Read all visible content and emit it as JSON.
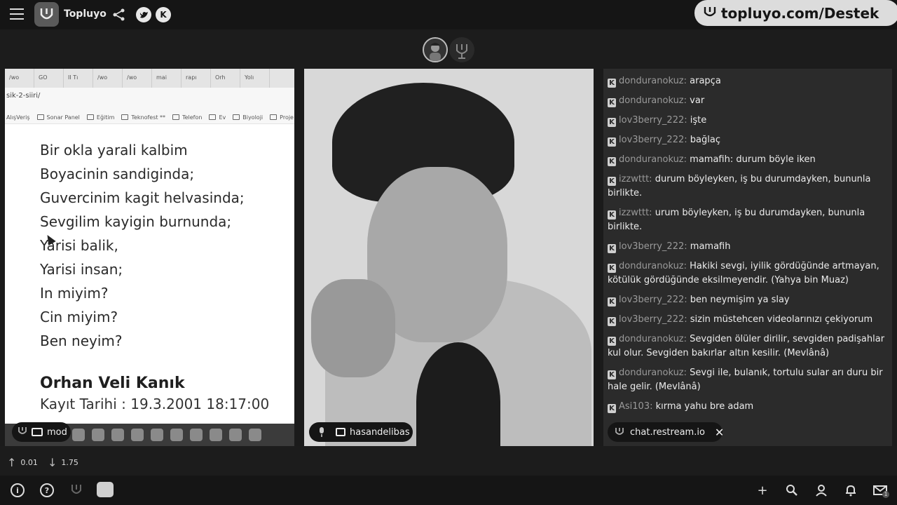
{
  "app": {
    "title": "Topluyo",
    "support_label": "topluyo.com/Destek"
  },
  "browser": {
    "tabs": [
      "/wo",
      "GO",
      "II Tı",
      "/wo",
      "/wo",
      "mai",
      "rapı",
      "Orh",
      "Yolı"
    ],
    "url": "sik-2-siiri/",
    "bookmarks": [
      "AlışVeriş",
      "Sonar Panel",
      "Eğitim",
      "Teknofest **",
      "Telefon",
      "Ev",
      "Biyoloji",
      "Proje"
    ]
  },
  "poem": {
    "lines": [
      "Bir okla yarali kalbim",
      "Boyacinin sandiginda;",
      "Guvercinim kagit helvasinda;",
      "Sevgilim kayigin burnunda;",
      "Yarisi balik,",
      "Yarisi insan;",
      "In miyim?",
      "Cin miyim?",
      "Ben neyim?"
    ],
    "author": "Orhan Veli Kanık",
    "record": "Kayıt Tarihi : 19.3.2001 18:17:00"
  },
  "screen_pill": {
    "label": "mod"
  },
  "video_pill": {
    "label": "hasandelibas"
  },
  "chat": {
    "messages": [
      {
        "user": "donduranokuz:",
        "text": "arapça"
      },
      {
        "user": "donduranokuz:",
        "text": "var"
      },
      {
        "user": "lov3berry_222:",
        "text": "işte"
      },
      {
        "user": "lov3berry_222:",
        "text": "bağlaç"
      },
      {
        "user": "donduranokuz:",
        "text": "mamafih: durum böyle iken"
      },
      {
        "user": "izzwttt:",
        "text": "durum böyleyken, iş bu durumdayken, bununla birlikte."
      },
      {
        "user": "izzwttt:",
        "text": "urum böyleyken, iş bu durumdayken, bununla birlikte."
      },
      {
        "user": "lov3berry_222:",
        "text": "mamafih"
      },
      {
        "user": "donduranokuz:",
        "text": "Hakiki sevgi, iyilik gördüğünde artmayan, kötülük gördüğünde eksilmeyendir. (Yahya bin Muaz)"
      },
      {
        "user": "lov3berry_222:",
        "text": "ben neymişim ya slay"
      },
      {
        "user": "lov3berry_222:",
        "text": "sizin müstehcen videolarınızı çekiyorum"
      },
      {
        "user": "donduranokuz:",
        "text": "Sevgiden ölüler dirilir, sevgiden padişahlar kul olur. Sevgiden bakırlar altın kesilir. (Mevlânâ)"
      },
      {
        "user": "donduranokuz:",
        "text": "Sevgi ile, bulanık, tortulu sular arı duru bir hale gelir. (Mevlânâ)"
      },
      {
        "user": "Asi103:",
        "text": "kırma yahu bre adam"
      }
    ],
    "source_label": "chat.restream.io"
  },
  "stats": {
    "upload": "0.01",
    "download": "1.75"
  },
  "icons": {
    "menu": "menu-icon",
    "share": "share-icon",
    "twitter": "twitter-icon",
    "kick": "kick-icon",
    "info": "info-icon",
    "help": "help-icon",
    "plus": "plus-icon",
    "search": "search-icon",
    "user": "user-icon",
    "bell": "bell-icon",
    "mail": "mail-icon"
  },
  "bottom": {
    "mail_badge": "1"
  }
}
